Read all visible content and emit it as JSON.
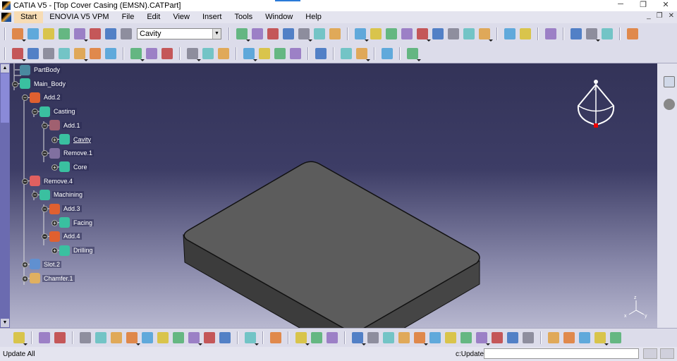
{
  "window": {
    "title": "CATIA V5 - [Top Cover Casing (EMSN).CATPart]",
    "min": "─",
    "restore": "❐",
    "close": "✕"
  },
  "menu": {
    "items": [
      "Start",
      "ENOVIA V5 VPM",
      "File",
      "Edit",
      "View",
      "Insert",
      "Tools",
      "Window",
      "Help"
    ],
    "win_min": "_",
    "win_restore": "❐",
    "win_close": "✕"
  },
  "toolbar1": {
    "combo_value": "Cavity",
    "icons_left": [
      "update-icon",
      "hand-icon",
      "axis-icon",
      "measure-icon",
      "body-icon",
      "switch-icon",
      "list-icon",
      "layer-icon"
    ],
    "icons_right": [
      "pad-icon",
      "pocket-icon",
      "shaft-icon",
      "rib-icon",
      "hole-icon",
      "target-icon",
      "box-icon",
      "sep",
      "sketch-icon",
      "tree-icon",
      "binocular-icon",
      "cylinder-icon",
      "frame-icon",
      "wing-icon",
      "plane-icon",
      "tool-icon",
      "cut-icon",
      "sep",
      "copy-icon",
      "grid-icon",
      "sep",
      "arrow-select-icon",
      "sep",
      "analysis-icon",
      "catalog-icon",
      "grid-snap-icon",
      "sep",
      "compass-icon"
    ]
  },
  "toolbar2": {
    "icons": [
      "formula-icon",
      "comment-icon",
      "lock-small-icon",
      "table-icon",
      "hierarchy-icon",
      "lock-icon",
      "equation-icon",
      "sep",
      "point-icon",
      "line-icon",
      "plane-icon",
      "sep",
      "gear-body-icon",
      "gear-hand-icon",
      "gear-tree-icon",
      "sep",
      "box-open-icon",
      "layers-icon",
      "pill-icon",
      "panel-icon",
      "sep",
      "hex-icon",
      "sep",
      "mirror-icon",
      "assemble-icon",
      "sep",
      "link-icon",
      "sep",
      "material-icon"
    ]
  },
  "tree": [
    {
      "label": "PartBody",
      "depth": 1,
      "color": "#4a8aa0"
    },
    {
      "label": "Main_Body",
      "depth": 1,
      "color": "#3ac0a0",
      "tog": "−"
    },
    {
      "label": "Add.2",
      "depth": 2,
      "color": "#e06030",
      "tog": "−"
    },
    {
      "label": "Casting",
      "depth": 3,
      "color": "#3ac0a0",
      "tog": "−"
    },
    {
      "label": "Add.1",
      "depth": 4,
      "color": "#a06070",
      "tog": "−"
    },
    {
      "label": "Cavity",
      "depth": 5,
      "color": "#3ac0a0",
      "tog": "+",
      "underline": true
    },
    {
      "label": "Remove.1",
      "depth": 4,
      "color": "#8070a0",
      "tog": "−"
    },
    {
      "label": "Core",
      "depth": 5,
      "color": "#3ac0a0",
      "tog": "+"
    },
    {
      "label": "Remove.4",
      "depth": 2,
      "color": "#e06060",
      "tog": "−"
    },
    {
      "label": "Machining",
      "depth": 3,
      "color": "#3ac0a0",
      "tog": "−"
    },
    {
      "label": "Add.3",
      "depth": 4,
      "color": "#e06030",
      "tog": "−"
    },
    {
      "label": "Facing",
      "depth": 5,
      "color": "#3ac0a0",
      "tog": "+"
    },
    {
      "label": "Add.4",
      "depth": 4,
      "color": "#e06030",
      "tog": "−"
    },
    {
      "label": "Drilling",
      "depth": 5,
      "color": "#3ac0a0",
      "tog": "+"
    },
    {
      "label": "Slot.2",
      "depth": 2,
      "color": "#6090d0",
      "tog": "+"
    },
    {
      "label": "Chamfer.1",
      "depth": 2,
      "color": "#e0b060",
      "tog": "+"
    }
  ],
  "toolbar3": {
    "icons": [
      "sketcher-icon",
      "sep",
      "workbench-icon",
      "tools-icon",
      "sep",
      "new-icon",
      "open-icon",
      "save-icon",
      "print-icon",
      "cut-icon",
      "copy-icon",
      "paste-icon",
      "undo-icon",
      "redo-icon",
      "whats-this-icon",
      "sep",
      "macro-icon",
      "sep",
      "camera-icon",
      "sep",
      "swap-icon",
      "tree-view-icon",
      "cylinder-view-icon",
      "sep",
      "fly-icon",
      "fit-all-icon",
      "pan-icon",
      "rotate-icon",
      "zoom-in-icon",
      "zoom-out-icon",
      "normal-view-icon",
      "multi-view-icon",
      "iso-view-icon",
      "shading-icon",
      "hide-show-icon",
      "swap-space-icon",
      "sep",
      "part-design-icon",
      "surface-icon",
      "analysis-icon",
      "section-icon",
      "catia-logo"
    ]
  },
  "compass": {
    "label": "z"
  },
  "axis": {
    "z": "z",
    "x": "x",
    "y": "y"
  },
  "status": {
    "message": "Update All",
    "command_label": "c:Update",
    "command_value": ""
  },
  "colors": {
    "part_top": "#5c5c5c",
    "part_side": "#3e3e3e",
    "accent": "#f7dcb4"
  }
}
